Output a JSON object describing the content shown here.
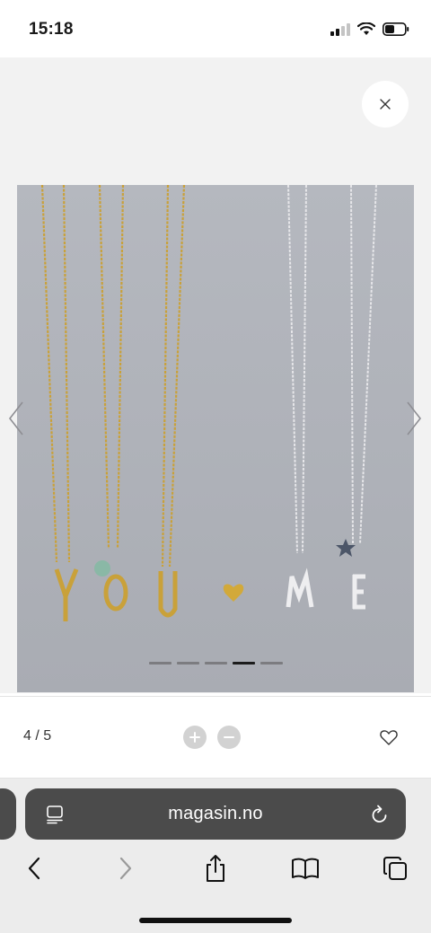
{
  "status_bar": {
    "time": "15:18",
    "icons": [
      "signal-icon",
      "wifi-icon",
      "battery-icon"
    ]
  },
  "viewer": {
    "close_icon": "close-icon",
    "arrows": [
      "chevron-left-icon",
      "chevron-right-icon"
    ],
    "image": {
      "letters": [
        "Y",
        "O",
        "U",
        "M",
        "E"
      ],
      "slide_count": 5,
      "active_slide": 4
    }
  },
  "controls": {
    "counter": "4 / 5",
    "zoom_in_icon": "plus-icon",
    "zoom_out_icon": "minus-icon",
    "favorite_icon": "heart-icon"
  },
  "safari": {
    "url": "magasin.no",
    "toolbar": [
      "back-icon",
      "forward-icon",
      "share-icon",
      "bookmarks-icon",
      "tabs-icon"
    ]
  },
  "colors": {
    "photo_background": "#b9bcc3",
    "gold": "#c9a13a",
    "silver": "#e8e8ea",
    "address_bar": "#4b4b4b"
  }
}
